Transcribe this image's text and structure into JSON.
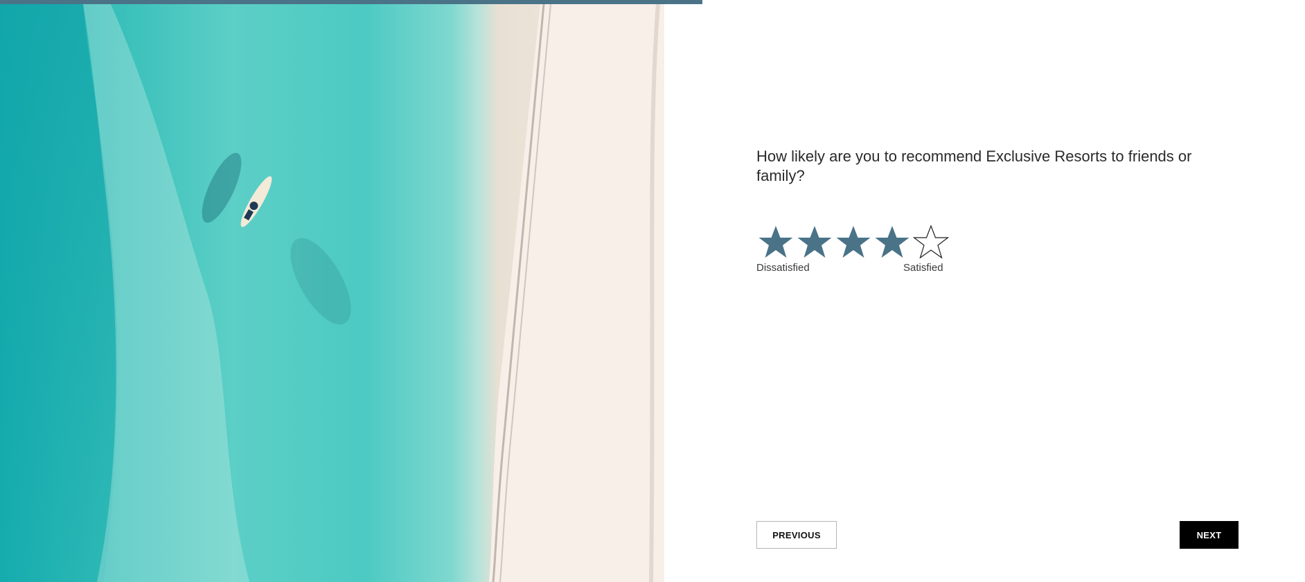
{
  "progress": {
    "fraction": 0.538,
    "color": "#4a7388"
  },
  "hero_image": {
    "description_icon": "beach-aerial-photo"
  },
  "survey": {
    "question": "How likely are you to recommend Exclusive Resorts to friends or family?",
    "rating": {
      "value": 4,
      "max": 5,
      "filled_color": "#4a7388",
      "empty_color": "#1f1f1f"
    },
    "low_label": "Dissatisfied",
    "high_label": "Satisfied"
  },
  "nav": {
    "previous_label": "PREVIOUS",
    "next_label": "NEXT"
  }
}
